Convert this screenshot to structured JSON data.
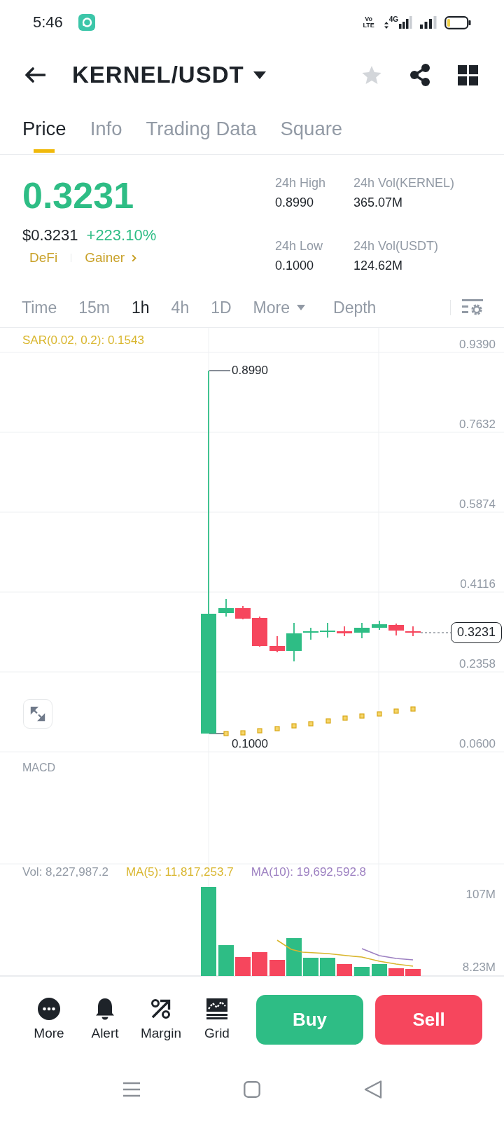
{
  "status_bar": {
    "time": "5:46",
    "volte": "Vo LTE",
    "network": "4G"
  },
  "header": {
    "title": "KERNEL/USDT"
  },
  "tabs": [
    {
      "label": "Price",
      "selected": true
    },
    {
      "label": "Info",
      "selected": false
    },
    {
      "label": "Trading Data",
      "selected": false
    },
    {
      "label": "Square",
      "selected": false
    }
  ],
  "price": {
    "last": "0.3231",
    "fiat": "$0.3231",
    "change": "+223.10%",
    "tags": [
      "DeFi",
      "Gainer"
    ]
  },
  "stats": [
    {
      "label": "24h High",
      "value": "0.8990"
    },
    {
      "label": "24h Vol(KERNEL)",
      "value": "365.07M"
    },
    {
      "label": "24h Low",
      "value": "0.1000"
    },
    {
      "label": "24h Vol(USDT)",
      "value": "124.62M"
    }
  ],
  "intervals": [
    {
      "label": "Time",
      "kind": "interval",
      "selected": false
    },
    {
      "label": "15m",
      "kind": "interval",
      "selected": false
    },
    {
      "label": "1h",
      "kind": "interval",
      "selected": true
    },
    {
      "label": "4h",
      "kind": "interval",
      "selected": false
    },
    {
      "label": "1D",
      "kind": "interval",
      "selected": false
    },
    {
      "label": "More",
      "kind": "dropdown",
      "selected": false
    },
    {
      "label": "Depth",
      "kind": "view",
      "selected": false
    }
  ],
  "price_chart": {
    "indicator": "SAR(0.02, 0.2): 0.1543",
    "axis_labels": [
      "0.9390",
      "0.7632",
      "0.5874",
      "0.4116",
      "0.2358",
      "0.0600"
    ],
    "high_label": "0.8990",
    "low_label": "0.1000",
    "last_price": "0.3231"
  },
  "macd": {
    "label": "MACD"
  },
  "volume_chart": {
    "legend": [
      {
        "text": "Vol: 8,227,987.2",
        "color": "#929aa5"
      },
      {
        "text": "MA(5): 11,817,253.7",
        "color": "#d9b62e"
      },
      {
        "text": "MA(10): 19,692,592.8",
        "color": "#9c7fc1"
      }
    ],
    "axis_labels": [
      "107M",
      "8.23M"
    ]
  },
  "actions": [
    {
      "label": "More"
    },
    {
      "label": "Alert"
    },
    {
      "label": "Margin"
    },
    {
      "label": "Grid"
    }
  ],
  "trade_buttons": [
    {
      "label": "Buy",
      "kind": "buy"
    },
    {
      "label": "Sell",
      "kind": "sell"
    }
  ]
}
